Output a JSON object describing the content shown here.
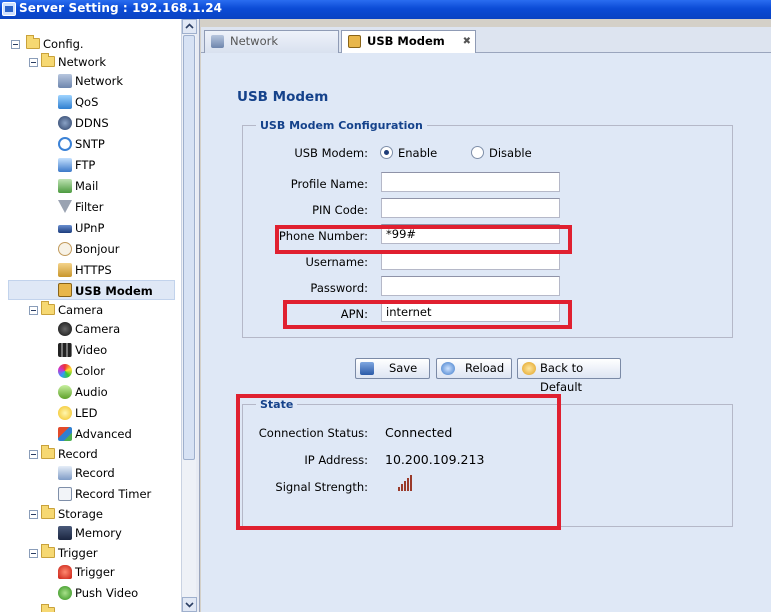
{
  "window": {
    "title": "Server Setting : 192.168.1.24"
  },
  "sidebar": {
    "items": [
      {
        "label": "Config.",
        "type": "folder"
      },
      {
        "label": "Network",
        "type": "folder"
      },
      {
        "label": "Network",
        "type": "leaf"
      },
      {
        "label": "QoS",
        "type": "leaf"
      },
      {
        "label": "DDNS",
        "type": "leaf"
      },
      {
        "label": "SNTP",
        "type": "leaf"
      },
      {
        "label": "FTP",
        "type": "leaf"
      },
      {
        "label": "Mail",
        "type": "leaf"
      },
      {
        "label": "Filter",
        "type": "leaf"
      },
      {
        "label": "UPnP",
        "type": "leaf"
      },
      {
        "label": "Bonjour",
        "type": "leaf"
      },
      {
        "label": "HTTPS",
        "type": "leaf"
      },
      {
        "label": "USB Modem",
        "type": "leaf",
        "selected": true
      },
      {
        "label": "Camera",
        "type": "folder"
      },
      {
        "label": "Camera",
        "type": "leaf"
      },
      {
        "label": "Video",
        "type": "leaf"
      },
      {
        "label": "Color",
        "type": "leaf"
      },
      {
        "label": "Audio",
        "type": "leaf"
      },
      {
        "label": "LED",
        "type": "leaf"
      },
      {
        "label": "Advanced",
        "type": "leaf"
      },
      {
        "label": "Record",
        "type": "folder"
      },
      {
        "label": "Record",
        "type": "leaf"
      },
      {
        "label": "Record Timer",
        "type": "leaf"
      },
      {
        "label": "Storage",
        "type": "folder"
      },
      {
        "label": "Memory",
        "type": "leaf"
      },
      {
        "label": "Trigger",
        "type": "folder"
      },
      {
        "label": "Trigger",
        "type": "leaf"
      },
      {
        "label": "Push Video",
        "type": "leaf"
      }
    ]
  },
  "tabs": [
    {
      "label": "Network",
      "active": false
    },
    {
      "label": "USB Modem",
      "active": true
    }
  ],
  "main": {
    "title": "USB Modem",
    "config": {
      "legend": "USB Modem Configuration",
      "usb_modem_label": "USB Modem:",
      "enable_label": "Enable",
      "disable_label": "Disable",
      "selected": "Enable",
      "profile_name_label": "Profile Name:",
      "profile_name_value": "",
      "pin_code_label": "PIN Code:",
      "pin_code_value": "",
      "phone_number_label": "Phone Number:",
      "phone_number_value": "*99#",
      "username_label": "Username:",
      "username_value": "",
      "password_label": "Password:",
      "password_value": "",
      "apn_label": "APN:",
      "apn_value": "internet"
    },
    "buttons": {
      "save": "Save",
      "reload": "Reload",
      "back_to_default": "Back to Default"
    },
    "state": {
      "legend": "State",
      "connection_status_label": "Connection Status:",
      "connection_status_value": "Connected",
      "ip_address_label": "IP Address:",
      "ip_address_value": "10.200.109.213",
      "signal_strength_label": "Signal Strength:"
    }
  },
  "colors": {
    "accent": "#15428b",
    "highlight": "#e02030",
    "panel_bg": "#dfe8f6"
  }
}
